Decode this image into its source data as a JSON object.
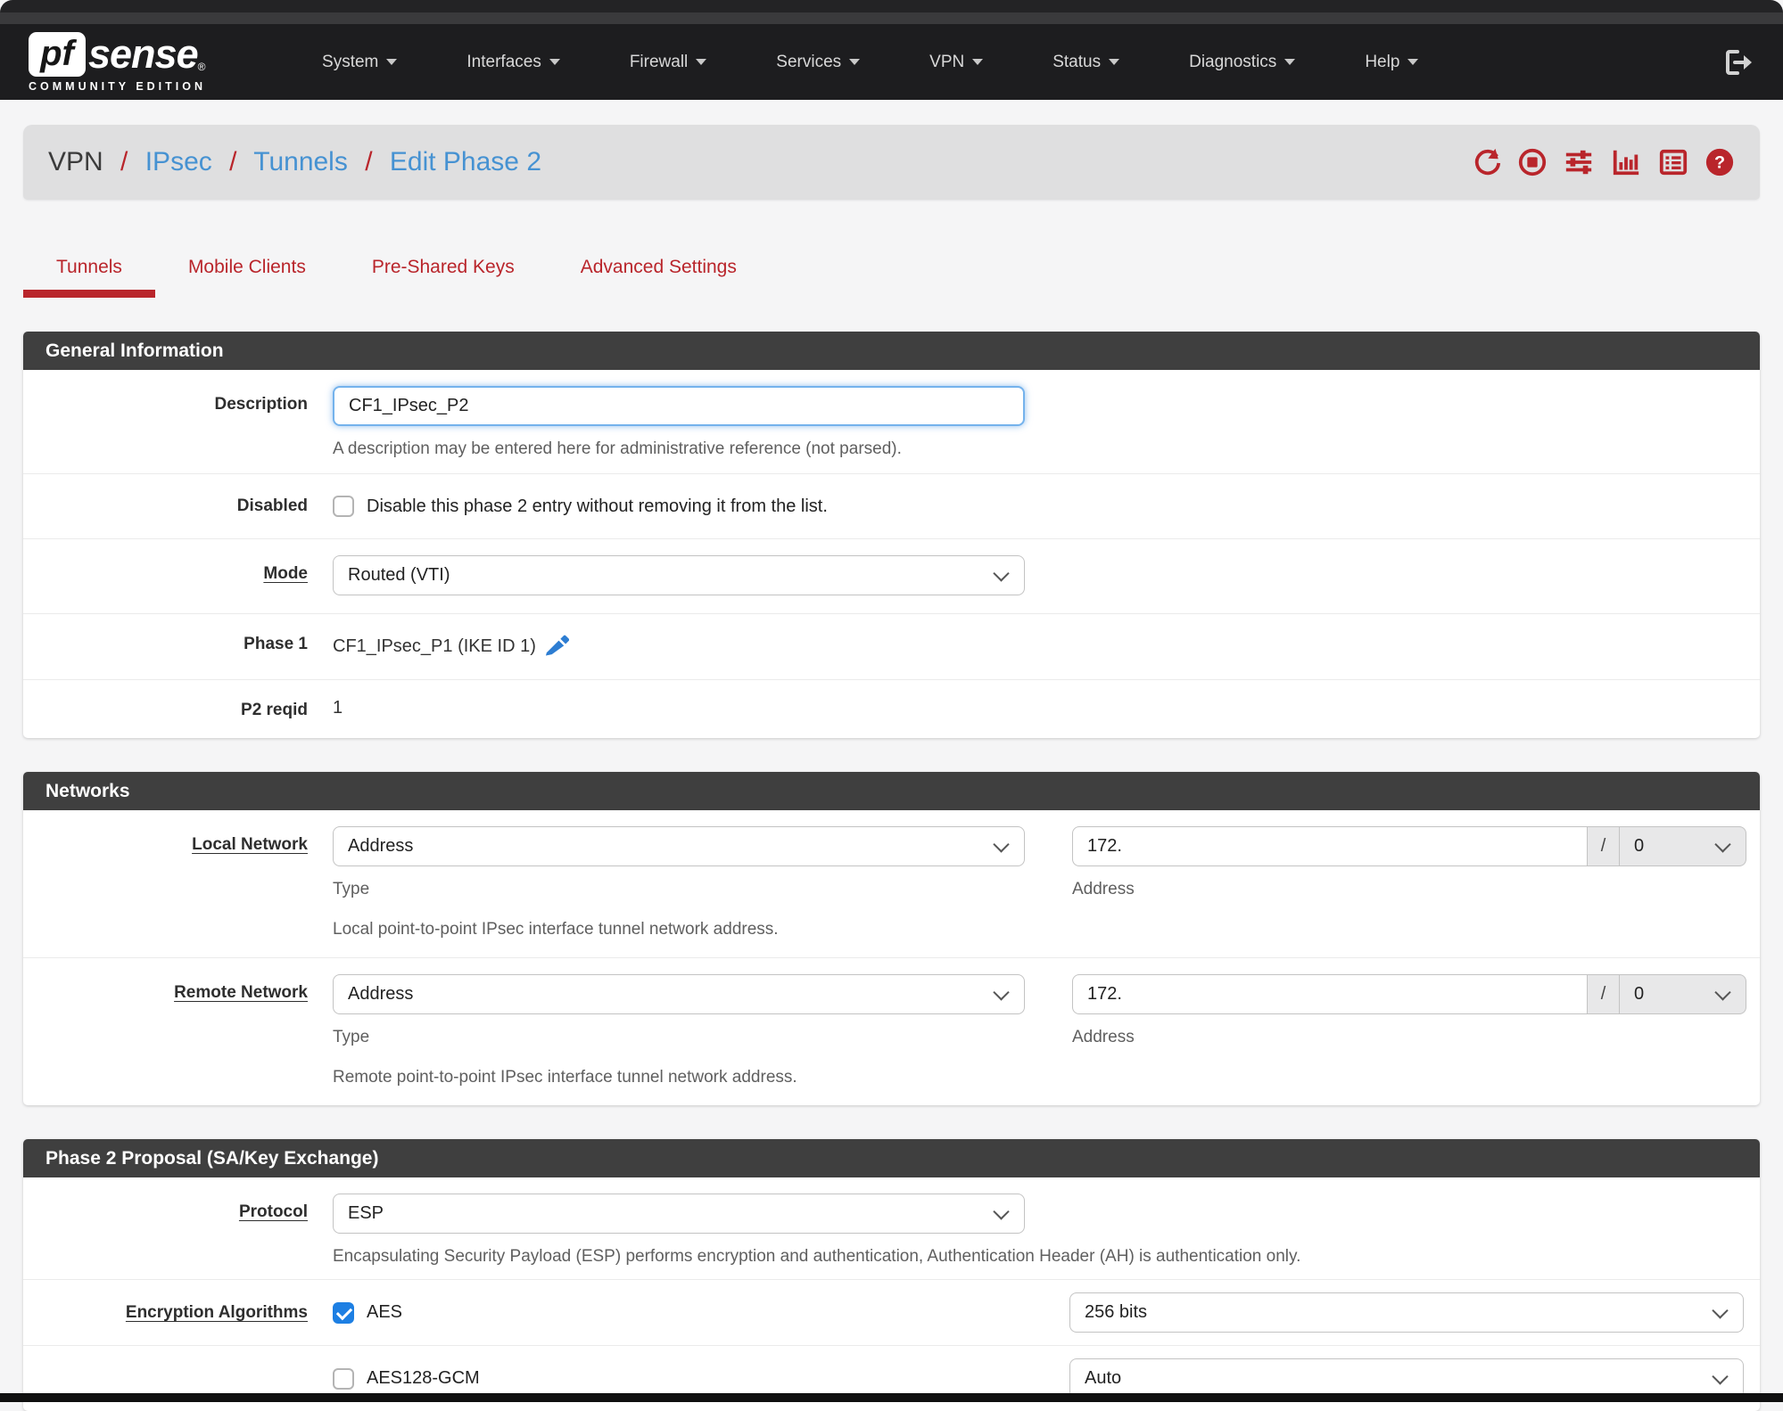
{
  "colors": {
    "accent_red": "#b9252b",
    "link_blue": "#4692d2",
    "panel_header_bg": "#3f3f3f",
    "navbar_bg": "#1d1d1f",
    "focus_blue": "#74b2ec",
    "checkbox_blue": "#1d7fe3"
  },
  "navbar": {
    "brand": {
      "pf": "pf",
      "sense": "sense",
      "reg": "®",
      "edition": "COMMUNITY EDITION"
    },
    "menu": [
      "System",
      "Interfaces",
      "Firewall",
      "Services",
      "VPN",
      "Status",
      "Diagnostics",
      "Help"
    ],
    "logout_icon": "sign-out-icon"
  },
  "breadcrumb": {
    "root": "VPN",
    "separator": "/",
    "links": [
      "IPsec",
      "Tunnels",
      "Edit Phase 2"
    ],
    "action_icons": [
      "refresh-icon",
      "stop-icon",
      "sliders-icon",
      "chart-icon",
      "log-list-icon",
      "help-icon"
    ]
  },
  "tabs": [
    {
      "label": "Tunnels",
      "active": true
    },
    {
      "label": "Mobile Clients",
      "active": false
    },
    {
      "label": "Pre-Shared Keys",
      "active": false
    },
    {
      "label": "Advanced Settings",
      "active": false
    }
  ],
  "general": {
    "title": "General Information",
    "description": {
      "label": "Description",
      "value": "CF1_IPsec_P2",
      "help": "A description may be entered here for administrative reference (not parsed)."
    },
    "disabled": {
      "label": "Disabled",
      "text": "Disable this phase 2 entry without removing it from the list.",
      "checked": false
    },
    "mode": {
      "label": "Mode",
      "value": "Routed (VTI)"
    },
    "phase1": {
      "label": "Phase 1",
      "value": "CF1_IPsec_P1 (IKE ID 1)",
      "edit_icon": "pencil-icon"
    },
    "p2reqid": {
      "label": "P2 reqid",
      "value": "1"
    }
  },
  "networks": {
    "title": "Networks",
    "local": {
      "label": "Local Network",
      "type_value": "Address",
      "type_help": "Type",
      "address_value": "172.",
      "address_help": "Address",
      "mask_separator": "/",
      "mask_value": "0",
      "help": "Local point-to-point IPsec interface tunnel network address."
    },
    "remote": {
      "label": "Remote Network",
      "type_value": "Address",
      "type_help": "Type",
      "address_value": "172.",
      "address_help": "Address",
      "mask_separator": "/",
      "mask_value": "0",
      "help": "Remote point-to-point IPsec interface tunnel network address."
    }
  },
  "proposal": {
    "title": "Phase 2 Proposal (SA/Key Exchange)",
    "protocol": {
      "label": "Protocol",
      "value": "ESP",
      "help": "Encapsulating Security Payload (ESP) performs encryption and authentication, Authentication Header (AH) is authentication only."
    },
    "encryption": {
      "label": "Encryption Algorithms",
      "rows": [
        {
          "name": "AES",
          "checked": true,
          "bits": "256 bits"
        },
        {
          "name": "AES128-GCM",
          "checked": false,
          "bits": "Auto"
        }
      ]
    }
  }
}
